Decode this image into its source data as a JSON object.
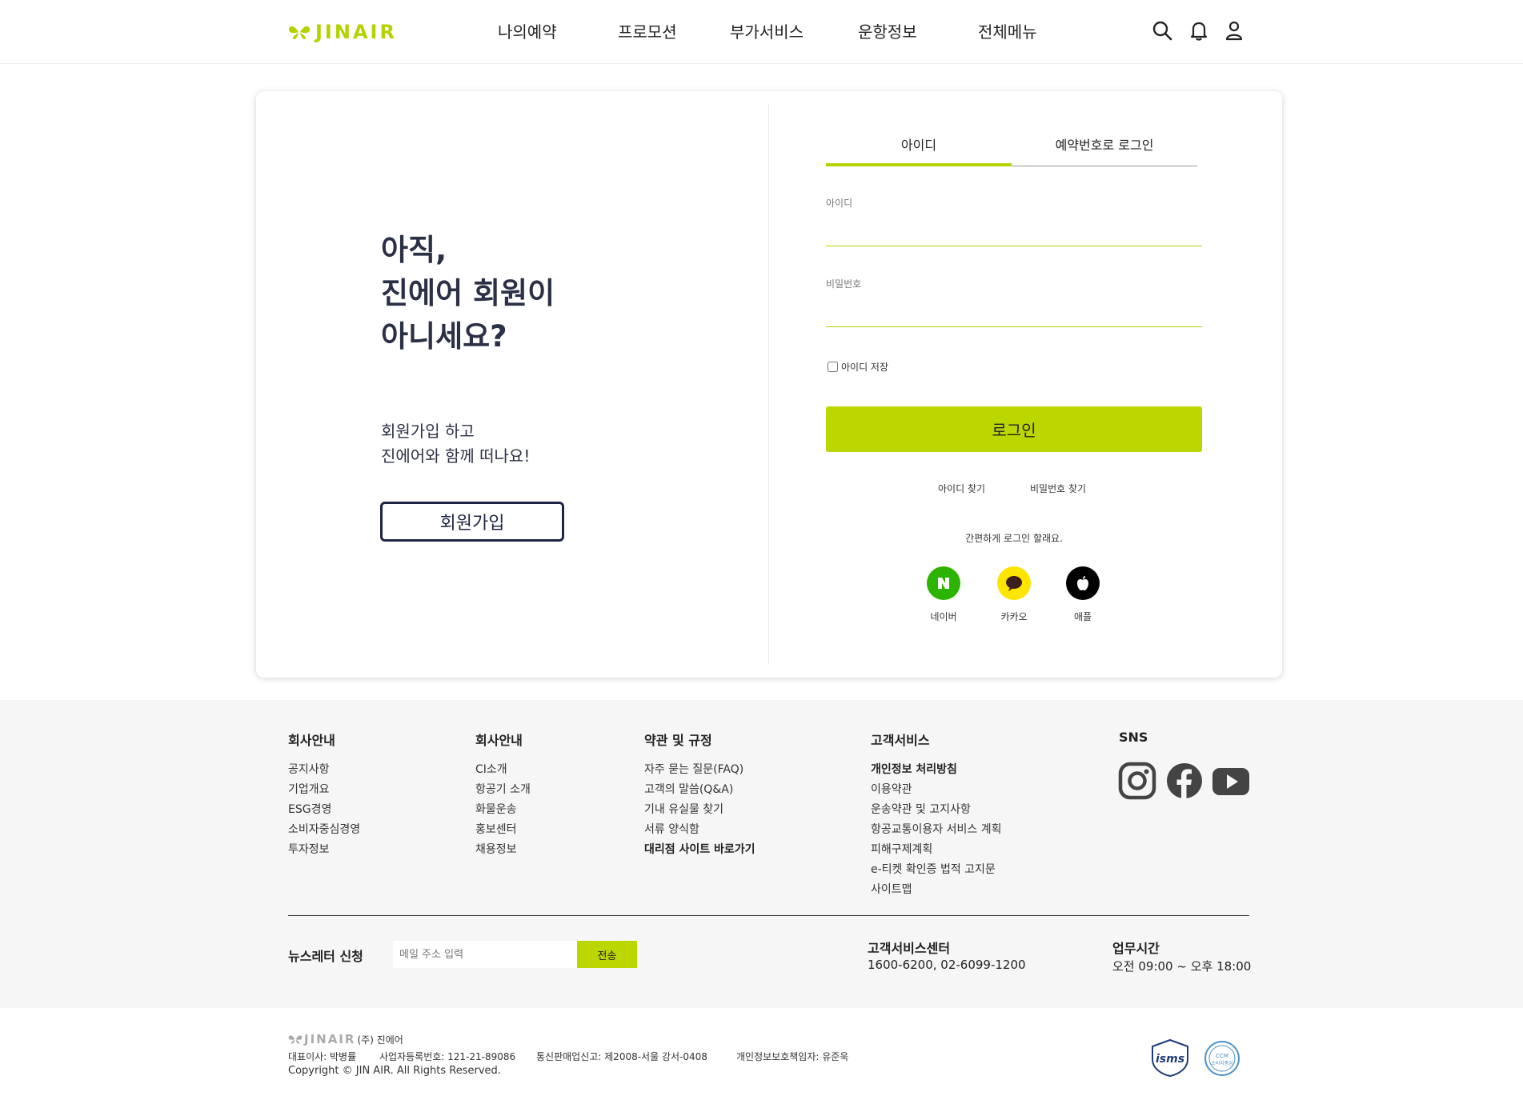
{
  "header": {
    "logo_text": "JINAIR",
    "nav": [
      "나의예약",
      "프로모션",
      "부가서비스",
      "운항정보",
      "전체메뉴"
    ],
    "icons": [
      "search-icon",
      "bell-icon",
      "user-icon"
    ]
  },
  "promo": {
    "title": "아직,\n진에어 회원이\n아니세요?",
    "subtitle": "회원가입 하고\n진에어와 함께 떠나요!",
    "join_label": "회원가입"
  },
  "login": {
    "tabs": [
      {
        "label": "아이디",
        "active": true
      },
      {
        "label": "예약번호로 로그인",
        "active": false
      }
    ],
    "id_label": "아이디",
    "id_value": "",
    "pw_label": "비밀번호",
    "pw_value": "",
    "remember_label": "아이디 저장",
    "remember_checked": false,
    "login_label": "로그인",
    "find_id": "아이디 찾기",
    "find_pw": "비밀번호 찾기",
    "easy_login": "간편하게 로그인 할래요.",
    "social": [
      {
        "label": "네이버",
        "icon": "naver-icon",
        "color": "#2db400"
      },
      {
        "label": "카카오",
        "icon": "kakao-icon",
        "color": "#fee500"
      },
      {
        "label": "애플",
        "icon": "apple-icon",
        "color": "#000000"
      }
    ]
  },
  "footer": {
    "columns": [
      {
        "title": "회사안내",
        "links": [
          "공지사항",
          "기업개요",
          "ESG경영",
          "소비자중심경영",
          "투자정보"
        ]
      },
      {
        "title": "회사안내",
        "links": [
          "CI소개",
          "항공기 소개",
          "화물운송",
          "홍보센터",
          "채용정보"
        ]
      },
      {
        "title": "약관 및 규정",
        "links": [
          "자주 묻는 질문(FAQ)",
          "고객의 말씀(Q&A)",
          "기내 유실물 찾기",
          "서류 양식함",
          "대리점 사이트 바로가기"
        ]
      },
      {
        "title": "고객서비스",
        "links": [
          "개인정보 처리방침",
          "이용약관",
          "운송약관 및 고지사항",
          "항공교통이용자 서비스 계획",
          "피해구제계획",
          "e-티켓 확인증 법적 고지문",
          "사이트맵"
        ]
      }
    ],
    "sns_title": "SNS",
    "sns": [
      "instagram-icon",
      "facebook-icon",
      "youtube-icon"
    ],
    "newsletter": {
      "title": "뉴스레터 신청",
      "placeholder": "메일 주소 입력",
      "button": "전송"
    },
    "cs": {
      "title": "고객서비스센터",
      "value": "1600-6200, 02-6099-1200"
    },
    "hours": {
      "title": "업무시간",
      "value": "오전 09:00 ~ 오후 18:00"
    }
  },
  "bottom": {
    "logo_text": "JINAIR",
    "corp": "(주) 진에어",
    "ceo": "대표이사: 박병률",
    "biz_no": "사업자등록번호: 121-21-89086",
    "telecom": "통신판매업신고: 제2008-서울 강서-0408",
    "privacy": "개인정보보호책임자: 유준욱",
    "copyright": "Copyright © JIN AIR. All Rights Reserved.",
    "badges": [
      "isms-badge",
      "consumer-centered-badge"
    ],
    "badge_text": {
      "isms": "isms",
      "ccm": "CCM",
      "ccm_sub": "소비자중심"
    }
  },
  "colors": {
    "accent": "#bcd600",
    "brand": "#b5d100",
    "navy": "#1e2544"
  }
}
